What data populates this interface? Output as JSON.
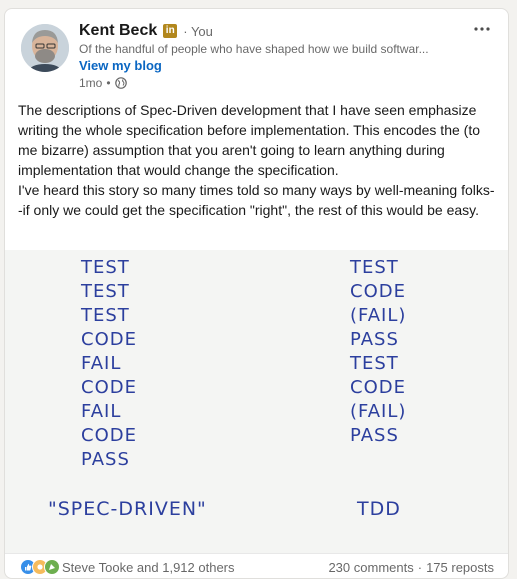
{
  "post": {
    "author_name": "Kent Beck",
    "badge": "in",
    "you_label": "· You",
    "headline": "Of the handful of people who have shaped how we build softwar...",
    "blog_link": "View my blog",
    "time": "1mo",
    "paragraph1": "The descriptions of Spec-Driven development that I have seen emphasize writing the whole specification before implementation. This encodes the (to me bizarre) assumption that you aren't going to learn anything during implementation that would change the specification.",
    "paragraph2": " I've heard this story so many times told so many ways by well-meaning folks--if only we could get the specification \"right\", the rest of this would be easy."
  },
  "image": {
    "left_column": [
      "TEST",
      "TEST",
      "TEST",
      "CODE",
      "FAIL",
      "CODE",
      "FAIL",
      "CODE",
      "PASS"
    ],
    "right_column": [
      "TEST",
      "CODE",
      "(FAIL)",
      "PASS",
      "TEST",
      "CODE",
      "(FAIL)",
      "PASS"
    ],
    "left_caption": "\"SPEC-DRIVEN\"",
    "right_caption": "TDD"
  },
  "footer": {
    "reactors": "Steve Tooke and 1,912 others",
    "comments": "230 comments",
    "reposts": "175 reposts"
  },
  "icons": {
    "more": "more-horizontal-icon",
    "globe": "globe-icon",
    "reactions": [
      "like-icon",
      "support-icon",
      "celebrate-icon"
    ]
  },
  "colors": {
    "link": "#0a66c2",
    "badge": "#b2871d",
    "ink": "#2c3f9e"
  }
}
